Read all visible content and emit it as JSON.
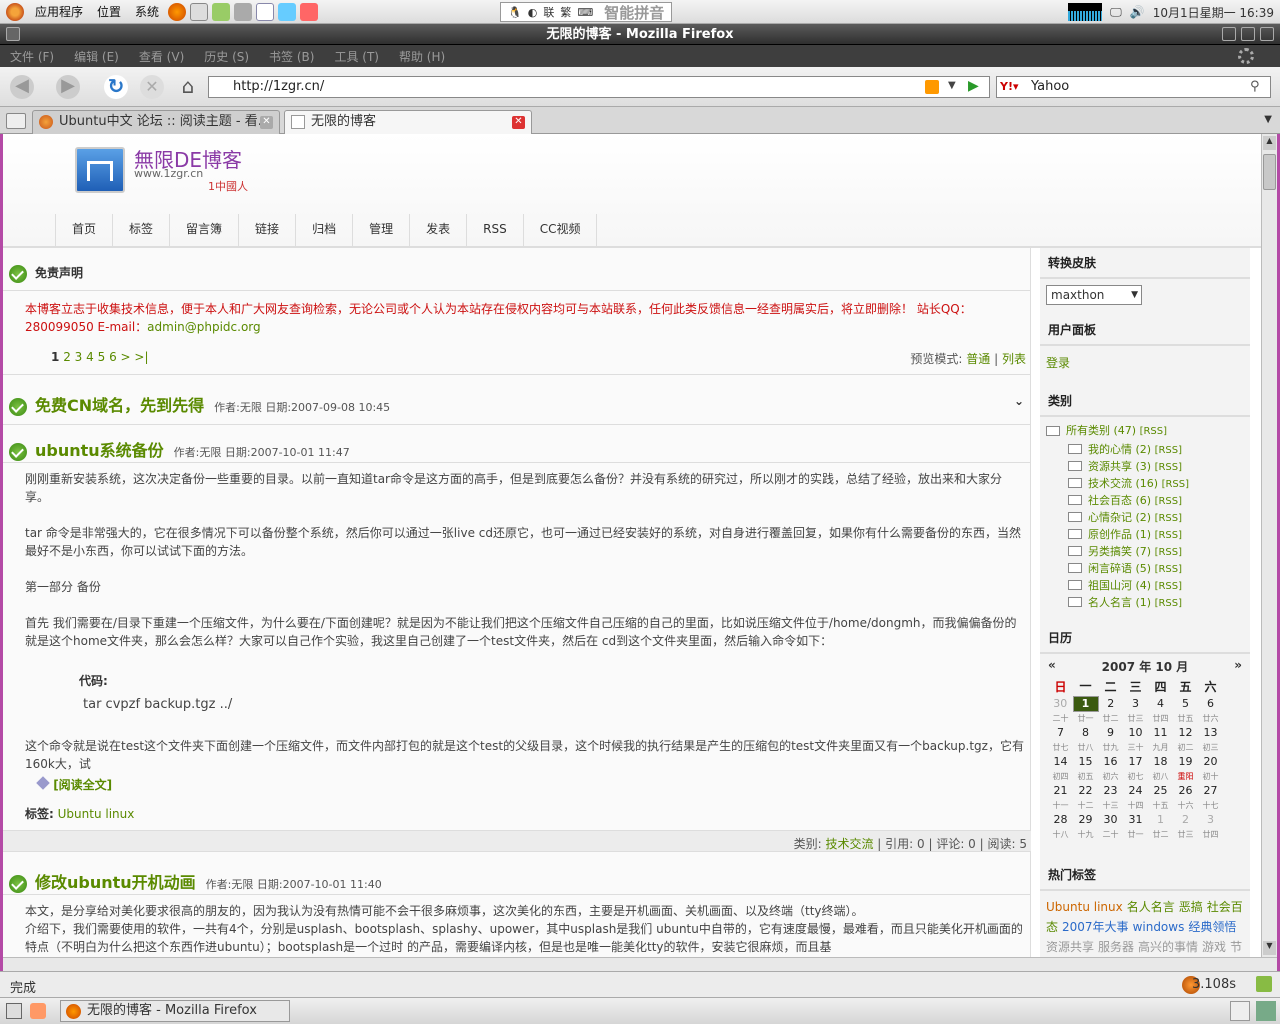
{
  "panel": {
    "menu": [
      "应用程序",
      "位置",
      "系统"
    ],
    "ime_label": "智能拼音",
    "ime_chars": [
      "联",
      "繁"
    ],
    "datetime": "10月1日星期一 16:39"
  },
  "window": {
    "title": "无限的博客 - Mozilla Firefox"
  },
  "menubar": [
    "文件 (F)",
    "编辑 (E)",
    "查看 (V)",
    "历史 (S)",
    "书签 (B)",
    "工具 (T)",
    "帮助 (H)"
  ],
  "nav": {
    "url": "http://1zgr.cn/",
    "search": "Yahoo"
  },
  "tabs": [
    {
      "label": "Ubuntu中文 论坛 :: 阅读主题 - 看..."
    },
    {
      "label": "无限的博客"
    }
  ],
  "blog": {
    "title": "無限DE博客",
    "url": "www.1zgr.cn",
    "tagline": "1中國人",
    "menu": [
      "首页",
      "标签",
      "留言簿",
      "链接",
      "归档",
      "管理",
      "发表",
      "RSS",
      "CC视频"
    ],
    "disclaimer_title": "免责声明",
    "disclaimer_text": "本博客立志于收集技术信息，便于本人和广大网友查询检索，无论公司或个人认为本站存在侵权内容均可与本站联系，任何此类反馈信息一经查明属实后，将立即删除！ 站长QQ：280099050 E-mail：",
    "disclaimer_email": "admin@phpidc.org",
    "pagination": [
      "1",
      "2",
      "3",
      "4",
      "5",
      "6",
      ">",
      ">|"
    ],
    "preview_mode": "预览模式:",
    "preview_normal": "普通",
    "preview_list": "列表",
    "posts": [
      {
        "title": "免费CN域名，先到先得",
        "meta": "作者:无限 日期:2007-09-08 10:45"
      },
      {
        "title": "ubuntu系统备份",
        "meta": "作者:无限 日期:2007-10-01 11:47",
        "p1": "刚刚重新安装系统，这次决定备份一些重要的目录。以前一直知道tar命令是这方面的高手，但是到底要怎么备份？并没有系统的研究过，所以刚才的实践，总结了经验，放出来和大家分享。",
        "p2": "tar 命令是非常强大的，它在很多情况下可以备份整个系统，然后你可以通过一张live cd还原它，也可一通过已经安装好的系统，对自身进行覆盖回复，如果你有什么需要备份的东西，当然最好不是小东西，你可以试试下面的方法。",
        "p3": "第一部分 备份",
        "p4": "首先 我们需要在/目录下重建一个压缩文件，为什么要在/下面创建呢？就是因为不能让我们把这个压缩文件自己压缩的自己的里面，比如说压缩文件位于/home/dongmh，而我偏偏备份的就是这个home文件夹，那么会怎么样？大家可以自己作个实验，我这里自己创建了一个test文件夹，然后在 cd到这个文件夹里面，然后输入命令如下：",
        "code_label": "代码:",
        "code": "tar cvpzf backup.tgz ../",
        "p5": "这个命令就是说在test这个文件夹下面创建一个压缩文件，而文件内部打包的就是这个test的父级目录，这个时候我的执行结果是产生的压缩包的test文件夹里面又有一个backup.tgz，它有160k大，试",
        "readmore": "[阅读全文]",
        "tags_label": "标签:",
        "tags": "Ubuntu linux",
        "footer": {
          "cat_label": "类别:",
          "cat": "技术交流",
          "ref": "引用: 0",
          "comments": "评论: 0",
          "reads": "阅读: 5"
        }
      },
      {
        "title": "修改ubuntu开机动画",
        "meta": "作者:无限 日期:2007-10-01 11:40",
        "p1": "本文，是分享给对美化要求很高的朋友的，因为我认为没有热情可能不会干很多麻烦事，这次美化的东西，主要是开机画面、关机画面、以及终端（tty终端）。",
        "p2": "介绍下，我们需要使用的软件，一共有4个，分别是usplash、bootsplash、splashy、upower，其中usplash是我们 ubuntu中自带的，它有速度最慢，最难看，而且只能美化开机画面的特点（不明白为什么把这个东西作进ubuntu）；bootsplash是一个过时 的产品，需要编译内核，但是也是唯一能美化tty的软件，安装它很麻烦，而且基"
      }
    ]
  },
  "sidebar": {
    "skin_title": "转换皮肤",
    "skin_value": "maxthon",
    "user_title": "用户面板",
    "login": "登录",
    "cat_title": "类别",
    "cat_all": "所有类别 (47)",
    "rss": "[RSS]",
    "categories": [
      "我的心情 (2)",
      "资源共享 (3)",
      "技术交流 (16)",
      "社会百态 (6)",
      "心情杂记 (2)",
      "原创作品 (1)",
      "另类搞笑 (7)",
      "闲言碎语 (5)",
      "祖国山河 (4)",
      "名人名言 (1)"
    ],
    "cal_title": "日历",
    "cal_month": "2007 年 10 月",
    "cal_prev": "«",
    "cal_next": "»",
    "weekdays": [
      "日",
      "一",
      "二",
      "三",
      "四",
      "五",
      "六"
    ],
    "cal_days": [
      [
        "30",
        "1",
        "2",
        "3",
        "4",
        "5",
        "6"
      ],
      [
        "7",
        "8",
        "9",
        "10",
        "11",
        "12",
        "13"
      ],
      [
        "14",
        "15",
        "16",
        "17",
        "18",
        "19",
        "20"
      ],
      [
        "21",
        "22",
        "23",
        "24",
        "25",
        "26",
        "27"
      ],
      [
        "28",
        "29",
        "30",
        "31",
        "1",
        "2",
        "3"
      ]
    ],
    "cal_lunar": [
      [
        "二十",
        "廿一",
        "廿二",
        "廿三",
        "廿四",
        "廿五",
        "廿六"
      ],
      [
        "廿七",
        "廿八",
        "廿九",
        "三十",
        "九月",
        "初二",
        "初三"
      ],
      [
        "初四",
        "初五",
        "初六",
        "初七",
        "初八",
        "重阳",
        "初十"
      ],
      [
        "十一",
        "十二",
        "十三",
        "十四",
        "十五",
        "十六",
        "十七"
      ],
      [
        "十八",
        "十九",
        "二十",
        "廿一",
        "廿二",
        "廿三",
        "廿四"
      ]
    ],
    "tags_title": "热门标签",
    "hot_tags": [
      "Ubuntu linux",
      "名人名言",
      "恶搞",
      "社会百态",
      "2007年大事",
      "windows",
      "经典领悟",
      "资源共享",
      "服务器",
      "高兴的事情",
      "游戏",
      "节日"
    ]
  },
  "status": {
    "text": "完成",
    "time": "3.108s"
  },
  "taskbar": {
    "label": "无限的博客 - Mozilla Firefox"
  }
}
